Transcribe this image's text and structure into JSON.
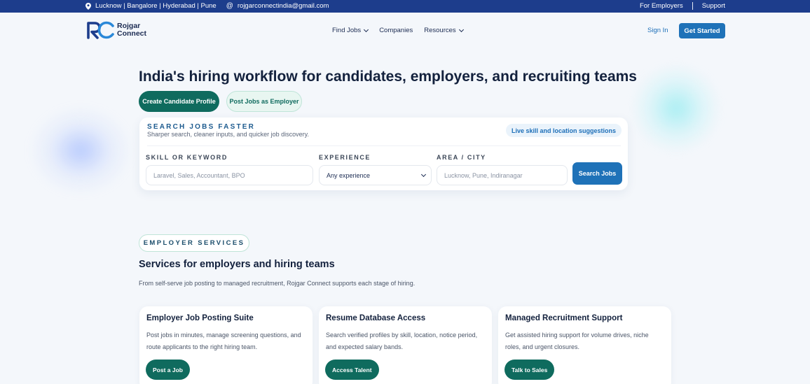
{
  "topbar": {
    "locations": "Lucknow | Bangalore | Hyderabad | Pune",
    "email": "rojgarconnectindia@gmail.com",
    "for_employers": "For Employers",
    "support": "Support"
  },
  "header": {
    "logo_line1": "Rojgar",
    "logo_line2": "Connect",
    "nav": [
      "Find Jobs",
      "Companies",
      "Resources"
    ],
    "sign_in": "Sign In",
    "get_started": "Get Started"
  },
  "hero": {
    "title": "India's hiring workflow for candidates, employers, and recruiting teams",
    "primary_cta": "Create Candidate Profile",
    "secondary_cta": "Post Jobs as Employer"
  },
  "search": {
    "title": "SEARCH JOBS FASTER",
    "subtitle": "Sharper search, cleaner inputs, and quicker job discovery.",
    "badge": "Live skill and location suggestions",
    "skill_label": "SKILL OR KEYWORD",
    "skill_placeholder": "Laravel, Sales, Accountant, BPO",
    "experience_label": "EXPERIENCE",
    "experience_value": "Any experience",
    "area_label": "AREA / CITY",
    "area_placeholder": "Lucknow, Pune, Indiranagar",
    "button": "Search Jobs"
  },
  "services": {
    "badge": "EMPLOYER SERVICES",
    "title": "Services for employers and hiring teams",
    "subtitle": "From self-serve job posting to managed recruitment, Rojgar Connect supports each stage of hiring.",
    "cards": [
      {
        "title": "Employer Job Posting Suite",
        "description": "Post jobs in minutes, manage screening questions, and route applicants to the right hiring team.",
        "button": "Post a Job"
      },
      {
        "title": "Resume Database Access",
        "description": "Search verified profiles by skill, location, notice period, and expected salary bands.",
        "button": "Access Talent"
      },
      {
        "title": "Managed Recruitment Support",
        "description": "Get assisted hiring support for volume drives, niche roles, and urgent closures.",
        "button": "Talk to Sales"
      }
    ]
  },
  "colors": {
    "topbar": "#1d3d8c",
    "primary_blue": "#1f72b8",
    "primary_green": "#0f6b5e"
  }
}
